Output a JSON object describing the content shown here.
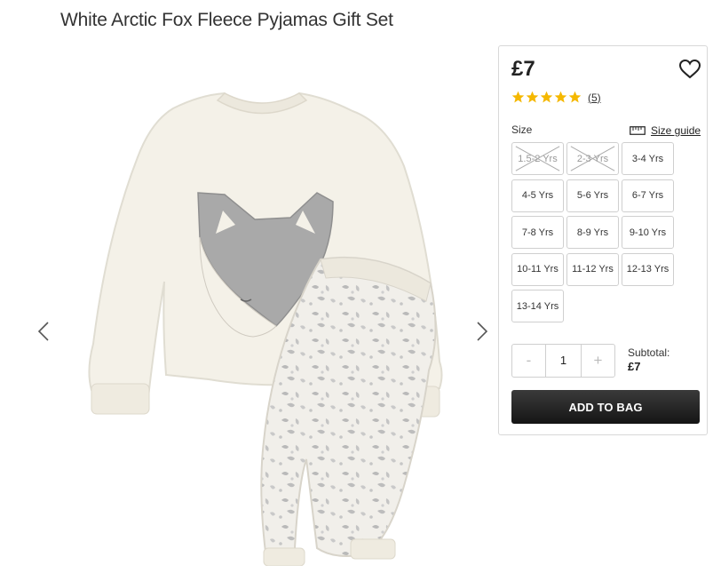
{
  "product": {
    "title": "White Arctic Fox Fleece Pyjamas Gift Set",
    "price": "£7",
    "rating": 5,
    "review_count": "(5)"
  },
  "gallery": {
    "prev_icon": "chevron-left-icon",
    "next_icon": "chevron-right-icon"
  },
  "sizes": {
    "label": "Size",
    "guide_label": "Size guide",
    "options": [
      {
        "label": "1.5-2 Yrs",
        "available": false
      },
      {
        "label": "2-3 Yrs",
        "available": false
      },
      {
        "label": "3-4 Yrs",
        "available": true
      },
      {
        "label": "4-5 Yrs",
        "available": true
      },
      {
        "label": "5-6 Yrs",
        "available": true
      },
      {
        "label": "6-7 Yrs",
        "available": true
      },
      {
        "label": "7-8 Yrs",
        "available": true
      },
      {
        "label": "8-9 Yrs",
        "available": true
      },
      {
        "label": "9-10 Yrs",
        "available": true
      },
      {
        "label": "10-11 Yrs",
        "available": true
      },
      {
        "label": "11-12 Yrs",
        "available": true
      },
      {
        "label": "12-13 Yrs",
        "available": true
      },
      {
        "label": "13-14 Yrs",
        "available": true
      }
    ]
  },
  "quantity": {
    "minus": "-",
    "value": "1",
    "plus": "+"
  },
  "subtotal": {
    "label": "Subtotal:",
    "amount": "£7"
  },
  "cart": {
    "add_label": "ADD TO BAG"
  },
  "colors": {
    "star": "#f5b800",
    "button_dark": "#1c1c1c",
    "garment": "#f4f1e8",
    "fox_grey": "#a9a9a9"
  }
}
